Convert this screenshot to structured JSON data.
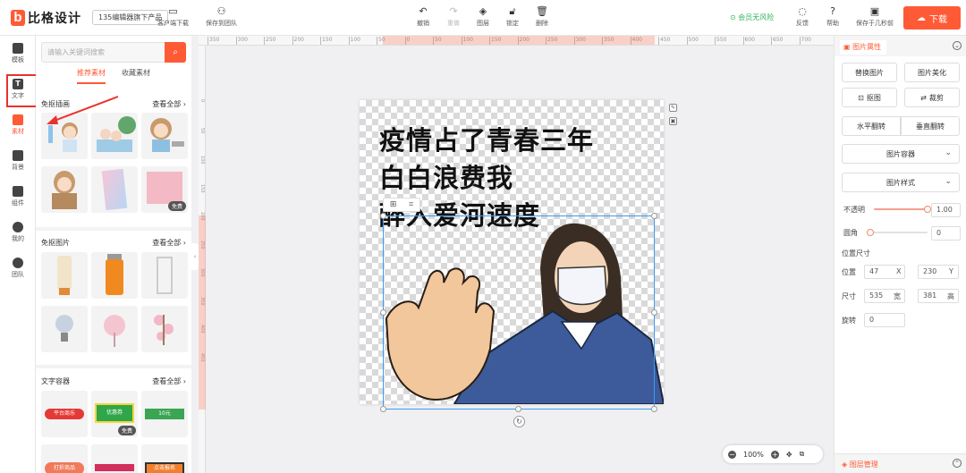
{
  "app": {
    "logo_letter": "b",
    "logo_name": "比格设计",
    "doc_title": "135编辑器旗下产品",
    "accent_color": "#ff5a36"
  },
  "toolbar": {
    "client_download": "客户端下载",
    "save_to_team": "保存到团队",
    "undo": "撤销",
    "redo": "重做",
    "layer": "图层",
    "lock": "锁定",
    "delete": "删除",
    "member_risk": "会员无风险",
    "feedback": "反馈",
    "help": "帮助",
    "save_status": "保存于几秒前",
    "download": "下载"
  },
  "rail": {
    "items": [
      {
        "label": "模板",
        "icon": "template-icon"
      },
      {
        "label": "文字",
        "icon": "text-icon",
        "glyph": "T"
      },
      {
        "label": "素材",
        "icon": "material-icon",
        "active": true
      },
      {
        "label": "背景",
        "icon": "background-icon"
      },
      {
        "label": "组件",
        "icon": "component-icon"
      },
      {
        "label": "我的",
        "icon": "user-icon"
      },
      {
        "label": "团队",
        "icon": "team-icon"
      }
    ]
  },
  "material": {
    "search_placeholder": "请输入关键词搜索",
    "tabs": [
      "推荐素材",
      "收藏素材"
    ],
    "more_label": "查看全部",
    "free_badge": "免费",
    "sections": [
      {
        "title": "免抠插画"
      },
      {
        "title": "免抠图片"
      },
      {
        "title": "文字容器"
      }
    ],
    "container_labels": [
      "平台商乐",
      "优惠券",
      "10元",
      "打折商品",
      "点击报名"
    ]
  },
  "ruler": {
    "h_ticks": [
      "350",
      "300",
      "250",
      "200",
      "150",
      "100",
      "50",
      "0",
      "50",
      "100",
      "150",
      "200",
      "250",
      "300",
      "350",
      "400",
      "450",
      "500",
      "550",
      "600",
      "650",
      "700"
    ],
    "v_ticks": [
      "0",
      "50",
      "100",
      "150",
      "200",
      "250",
      "300",
      "350",
      "400",
      "450"
    ]
  },
  "canvas": {
    "lines": [
      "疫情占了青春三年",
      "白白浪费我",
      "醉入爱河速度"
    ]
  },
  "zoom": {
    "level": "100%"
  },
  "properties": {
    "tab_label": "图片属性",
    "replace_image": "替换图片",
    "beautify_image": "图片美化",
    "cutout": "抠图",
    "crop": "裁剪",
    "flip_h": "水平翻转",
    "flip_v": "垂直翻转",
    "image_container": "图片容器",
    "image_style": "图片样式",
    "opacity_label": "不透明",
    "opacity_value": "1.00",
    "opacity_fraction": 1.0,
    "radius_label": "圆角",
    "radius_value": "0",
    "radius_fraction": 0,
    "size_pos_label": "位置尺寸",
    "position_label": "位置",
    "pos_x": "47",
    "pos_x_unit": "X",
    "pos_y": "230",
    "pos_y_unit": "Y",
    "size_label": "尺寸",
    "width": "535",
    "width_unit": "宽",
    "height": "381",
    "height_unit": "高",
    "rotate_label": "旋转",
    "rotate_value": "0",
    "layer_manage": "图层管理"
  }
}
